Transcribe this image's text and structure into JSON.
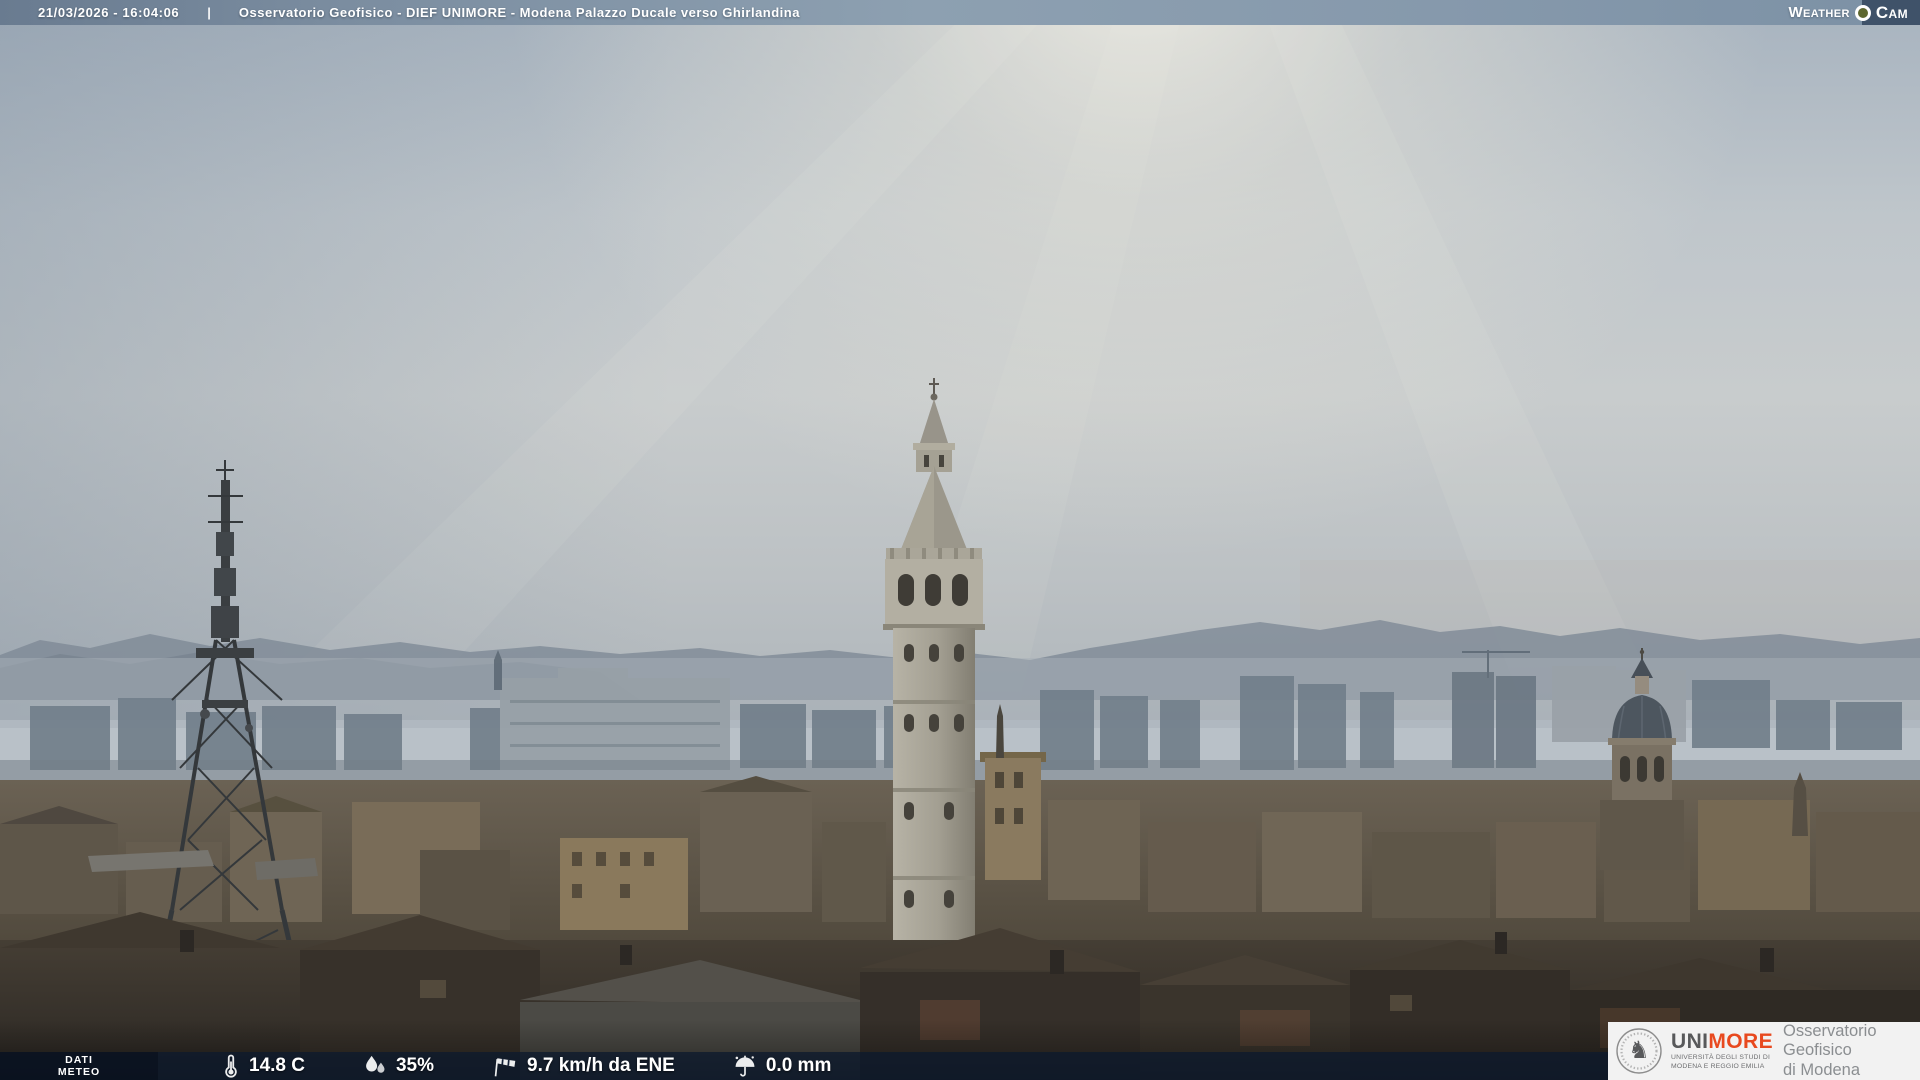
{
  "header": {
    "datetime": "21/03/2026 - 16:04:06",
    "separator": "|",
    "title": "Osservatorio Geofisico - DIEF UNIMORE - Modena Palazzo Ducale verso Ghirlandina",
    "weathercam": {
      "word1": "Weather",
      "word2": "Cam"
    }
  },
  "footer": {
    "label_line1": "DATI",
    "label_line2": "METEO",
    "temperature": "14.8 C",
    "humidity": "35%",
    "wind": "9.7 km/h da ENE",
    "rain": "0.0 mm"
  },
  "logo_panel": {
    "brand_uni": "UNI",
    "brand_more": "MORE",
    "subtitle_line1": "UNIVERSITÀ DEGLI STUDI DI",
    "subtitle_line2": "MODENA E REGGIO EMILIA",
    "org_line1": "Osservatorio Geofisico",
    "org_line2": "di Modena"
  },
  "colors": {
    "brand_red": "#e8491f",
    "cam_box_blue": "#3f5269",
    "bottom_bar_navy": "#0d192d",
    "top_bar_slate": "#7b8da0",
    "text_white": "#ffffff"
  }
}
